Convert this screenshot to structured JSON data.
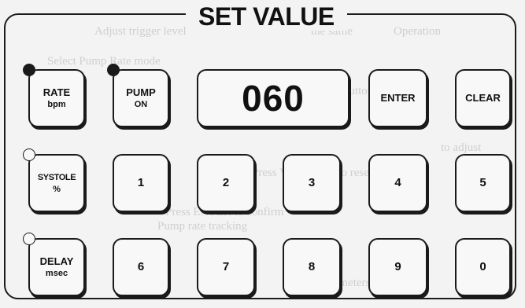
{
  "background_text": [
    "Operation",
    "Adjust trigger level",
    "the same",
    "Select Pump Rate mode",
    "Press Value (numeric) button",
    "to adjust",
    "Press Value twice to reset value",
    "Press ENTER to confirm",
    "Pump rate tracking",
    "these parameters to see"
  ],
  "panel": {
    "title": "SET VALUE"
  },
  "display": {
    "value": "060"
  },
  "keys": {
    "rate": {
      "label": "RATE",
      "sub": "bpm",
      "led": "on"
    },
    "pump": {
      "label": "PUMP",
      "sub": "ON",
      "led": "on"
    },
    "systole": {
      "label": "SYSTOLE",
      "sub": "%",
      "led": "off"
    },
    "delay": {
      "label": "DELAY",
      "sub": "msec",
      "led": "off"
    },
    "enter": {
      "label": "ENTER"
    },
    "clear": {
      "label": "CLEAR"
    },
    "digits": [
      "1",
      "2",
      "3",
      "4",
      "5",
      "6",
      "7",
      "8",
      "9",
      "0"
    ]
  },
  "colors": {
    "ink": "#1a1a1a",
    "paper": "#f3f3f3",
    "key_face": "#f8f8f8",
    "bleed_text": "#cfcfcf"
  }
}
